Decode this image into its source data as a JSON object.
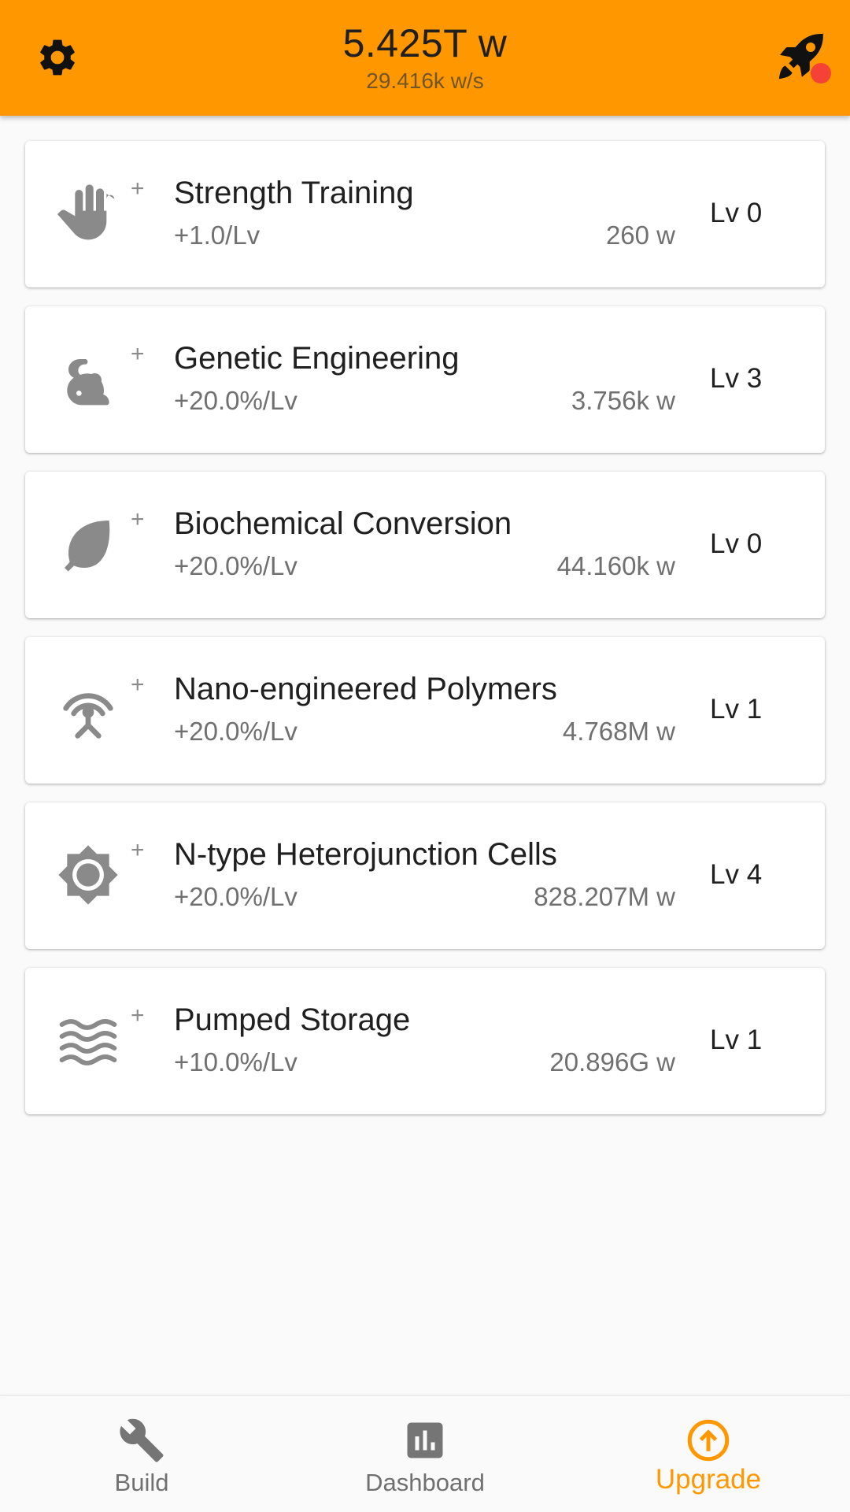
{
  "header": {
    "total": "5.425T w",
    "rate": "29.416k w/s",
    "settings_icon": "gear-icon",
    "rocket_icon": "rocket-icon",
    "accent": "#ff9800",
    "notification_color": "#f44336"
  },
  "upgrades": [
    {
      "icon": "hand-icon",
      "title": "Strength Training",
      "bonus": "+1.0/Lv",
      "cost": "260 w",
      "level": "Lv 0"
    },
    {
      "icon": "mouse-icon",
      "title": "Genetic Engineering",
      "bonus": "+20.0%/Lv",
      "cost": "3.756k w",
      "level": "Lv 3"
    },
    {
      "icon": "leaf-icon",
      "title": "Biochemical Conversion",
      "bonus": "+20.0%/Lv",
      "cost": "44.160k w",
      "level": "Lv 0"
    },
    {
      "icon": "antenna-icon",
      "title": "Nano-engineered Polymers",
      "bonus": "+20.0%/Lv",
      "cost": "4.768M w",
      "level": "Lv 1"
    },
    {
      "icon": "sun-icon",
      "title": "N-type Heterojunction Cells",
      "bonus": "+20.0%/Lv",
      "cost": "828.207M w",
      "level": "Lv 4"
    },
    {
      "icon": "waves-icon",
      "title": "Pumped Storage",
      "bonus": "+10.0%/Lv",
      "cost": "20.896G w",
      "level": "Lv 1"
    }
  ],
  "plus_glyph": "+",
  "nav": {
    "build_label": "Build",
    "dashboard_label": "Dashboard",
    "upgrade_label": "Upgrade",
    "active": "Upgrade",
    "icons": [
      "wrench-icon",
      "bar-chart-icon",
      "arrow-up-circle-icon"
    ]
  }
}
